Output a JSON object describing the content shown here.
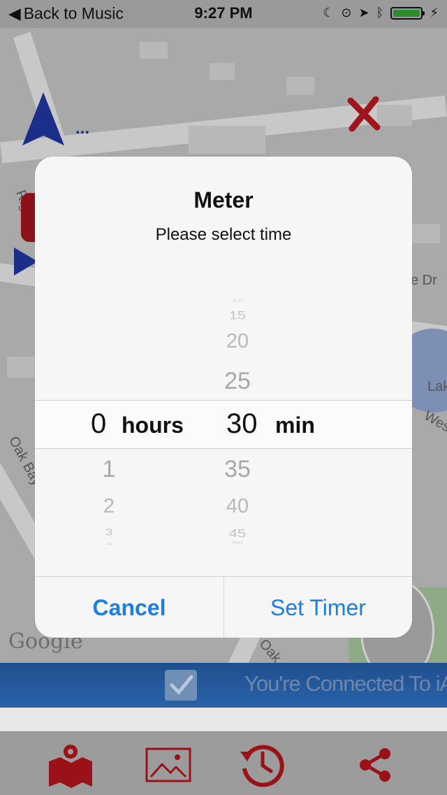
{
  "status_bar": {
    "back_label": "Back to Music",
    "time": "9:27 PM"
  },
  "map": {
    "labels": [
      "Riggsby Rd",
      "Oak Bay Dr",
      "Oak",
      "e Dr",
      "Lak",
      "Wes"
    ],
    "attribution": "Google"
  },
  "connected_bar": {
    "text": "You're Connected To iA"
  },
  "alert": {
    "title": "Meter",
    "message": "Please select time",
    "hours_unit": "hours",
    "minutes_unit": "min",
    "hours_selected": "0",
    "minutes_selected": "30",
    "hours_below": [
      "1",
      "2",
      "3",
      "4"
    ],
    "minutes_above": [
      "10",
      "15",
      "20",
      "25"
    ],
    "minutes_below": [
      "35",
      "40",
      "45",
      "50"
    ],
    "cancel_label": "Cancel",
    "confirm_label": "Set Timer"
  },
  "tab_bar": {
    "items": [
      "map-icon",
      "photo-icon",
      "history-icon",
      "share-icon"
    ]
  },
  "colors": {
    "accent_blue": "#1c7ee0",
    "tab_red": "#c1121f",
    "connected_bar": "#2b63a8"
  }
}
